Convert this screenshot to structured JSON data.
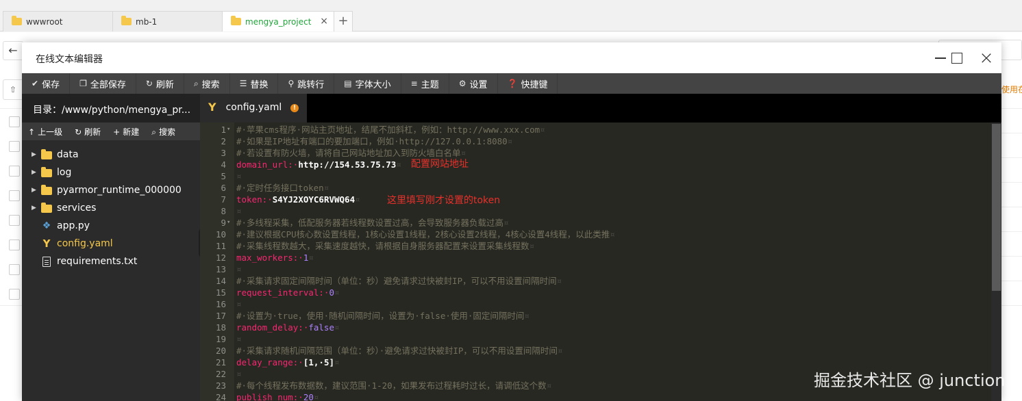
{
  "browser_tabs": [
    {
      "label": "wwwroot",
      "active": false
    },
    {
      "label": "mb-1",
      "active": false
    },
    {
      "label": "mengya_project",
      "active": true
    }
  ],
  "background": {
    "right_hint": "使用在"
  },
  "editor": {
    "title": "在线文本编辑器",
    "toolbar": [
      {
        "icon": "check-icon",
        "glyph": "✔",
        "label": "保存"
      },
      {
        "icon": "copy-icon",
        "glyph": "❐",
        "label": "全部保存"
      },
      {
        "icon": "refresh-icon",
        "glyph": "↻",
        "label": "刷新"
      },
      {
        "icon": "search-icon",
        "glyph": "⌕",
        "label": "搜索"
      },
      {
        "icon": "replace-icon",
        "glyph": "☰",
        "label": "替换"
      },
      {
        "icon": "jump-icon",
        "glyph": "⚲",
        "label": "跳转行"
      },
      {
        "icon": "font-size-icon",
        "glyph": "▤",
        "label": "字体大小"
      },
      {
        "icon": "theme-icon",
        "glyph": "≡",
        "label": "主题"
      },
      {
        "icon": "gear-icon",
        "glyph": "⚙",
        "label": "设置"
      },
      {
        "icon": "help-icon",
        "glyph": "❓",
        "label": "快捷键"
      }
    ],
    "sidebar": {
      "directory": "目录：/www/python/mengya_pr...",
      "tools": [
        {
          "icon": "up-arrow-icon",
          "glyph": "↑",
          "label": "上一级"
        },
        {
          "icon": "refresh-icon",
          "glyph": "↻",
          "label": "刷新"
        },
        {
          "icon": "plus-icon",
          "glyph": "+",
          "label": "新建"
        },
        {
          "icon": "search-icon",
          "glyph": "⌕",
          "label": "搜索"
        }
      ],
      "tree": [
        {
          "name": "data",
          "type": "folder"
        },
        {
          "name": "log",
          "type": "folder"
        },
        {
          "name": "pyarmor_runtime_000000",
          "type": "folder"
        },
        {
          "name": "services",
          "type": "folder"
        },
        {
          "name": "app.py",
          "type": "python"
        },
        {
          "name": "config.yaml",
          "type": "yaml",
          "active": true
        },
        {
          "name": "requirements.txt",
          "type": "text"
        }
      ]
    },
    "open_file": {
      "name": "config.yaml",
      "modified_badge": "!"
    },
    "lines": [
      {
        "n": "1",
        "fold": true,
        "parts": [
          {
            "c": "comment",
            "t": "#·苹果cms程序·网站主页地址，结尾不加斜杠，例如：http://www.xxx.com"
          },
          {
            "c": "inv",
            "t": "¤"
          }
        ]
      },
      {
        "n": "2",
        "parts": [
          {
            "c": "comment",
            "t": "#·如果是IP地址有端口的要加端口，例如·http://127.0.0.1:8080"
          },
          {
            "c": "inv",
            "t": "¤"
          }
        ]
      },
      {
        "n": "3",
        "parts": [
          {
            "c": "comment",
            "t": "#·若设置有防火墙，请将自己网站地址加入到防火墙白名单"
          },
          {
            "c": "inv",
            "t": "¤"
          }
        ]
      },
      {
        "n": "4",
        "parts": [
          {
            "c": "key",
            "t": "domain_url:·"
          },
          {
            "c": "val",
            "t": "http://154.53.75.73"
          },
          {
            "c": "inv",
            "t": "¤"
          }
        ]
      },
      {
        "n": "5",
        "parts": [
          {
            "c": "inv",
            "t": "¤"
          }
        ]
      },
      {
        "n": "6",
        "parts": [
          {
            "c": "comment",
            "t": "#·定时任务接口token"
          },
          {
            "c": "inv",
            "t": "¤"
          }
        ]
      },
      {
        "n": "7",
        "parts": [
          {
            "c": "key",
            "t": "token:·"
          },
          {
            "c": "val",
            "t": "S4YJ2XOYC6RVWQ64"
          },
          {
            "c": "inv",
            "t": "¤"
          }
        ]
      },
      {
        "n": "8",
        "parts": [
          {
            "c": "inv",
            "t": "¤"
          }
        ]
      },
      {
        "n": "9",
        "fold": true,
        "parts": [
          {
            "c": "comment",
            "t": "#·多线程采集，低配服务器若线程数设置过高，会导致服务器负载过高"
          },
          {
            "c": "inv",
            "t": "¤"
          }
        ]
      },
      {
        "n": "10",
        "parts": [
          {
            "c": "comment",
            "t": "#·建议根据CPU核心数设置线程，1核心设置1线程，2核心设置2线程，4核心设置4线程，以此类推"
          },
          {
            "c": "inv",
            "t": "¤"
          }
        ]
      },
      {
        "n": "11",
        "parts": [
          {
            "c": "comment",
            "t": "#·采集线程数越大，采集速度越快，请根据自身服务器配置来设置采集线程数"
          },
          {
            "c": "inv",
            "t": "¤"
          }
        ]
      },
      {
        "n": "12",
        "parts": [
          {
            "c": "key",
            "t": "max_workers:·"
          },
          {
            "c": "num",
            "t": "1"
          },
          {
            "c": "inv",
            "t": "¤"
          }
        ]
      },
      {
        "n": "13",
        "parts": [
          {
            "c": "inv",
            "t": "¤"
          }
        ]
      },
      {
        "n": "14",
        "parts": [
          {
            "c": "comment",
            "t": "#·采集请求固定间隔时间（单位：秒）避免请求过快被封IP，可以不用设置间隔时间"
          },
          {
            "c": "inv",
            "t": "¤"
          }
        ]
      },
      {
        "n": "15",
        "parts": [
          {
            "c": "key",
            "t": "request_interval:·"
          },
          {
            "c": "num",
            "t": "0"
          },
          {
            "c": "inv",
            "t": "¤"
          }
        ]
      },
      {
        "n": "16",
        "parts": [
          {
            "c": "inv",
            "t": "¤"
          }
        ]
      },
      {
        "n": "17",
        "parts": [
          {
            "c": "comment",
            "t": "#·设置为·true，使用·随机间隔时间，设置为·false·使用·固定间隔时间"
          },
          {
            "c": "inv",
            "t": "¤"
          }
        ]
      },
      {
        "n": "18",
        "parts": [
          {
            "c": "key",
            "t": "random_delay:·"
          },
          {
            "c": "num",
            "t": "false"
          },
          {
            "c": "inv",
            "t": "¤"
          }
        ]
      },
      {
        "n": "19",
        "parts": [
          {
            "c": "inv",
            "t": "¤"
          }
        ]
      },
      {
        "n": "20",
        "parts": [
          {
            "c": "comment",
            "t": "#·采集请求随机间隔范围（单位：秒）·避免请求过快被封IP，可以不用设置间隔时间"
          },
          {
            "c": "inv",
            "t": "¤"
          }
        ]
      },
      {
        "n": "21",
        "parts": [
          {
            "c": "key",
            "t": "delay_range:·"
          },
          {
            "c": "val",
            "t": "[1,·5]"
          },
          {
            "c": "inv",
            "t": "¤"
          }
        ]
      },
      {
        "n": "22",
        "parts": [
          {
            "c": "inv",
            "t": "¤"
          }
        ]
      },
      {
        "n": "23",
        "parts": [
          {
            "c": "comment",
            "t": "#·每个线程发布数据数，建议范围·1-20，如果发布过程耗时过长，请调低这个数"
          },
          {
            "c": "inv",
            "t": "¤"
          }
        ]
      },
      {
        "n": "24",
        "parts": [
          {
            "c": "key",
            "t": "publish_num:·"
          },
          {
            "c": "num",
            "t": "20"
          },
          {
            "c": "inv",
            "t": "¤"
          }
        ]
      }
    ],
    "annotations": {
      "domain_note": "配置网站地址",
      "token_note": "这里填写刚才设置的token"
    }
  },
  "watermark": "掘金技术社区 @ junction"
}
